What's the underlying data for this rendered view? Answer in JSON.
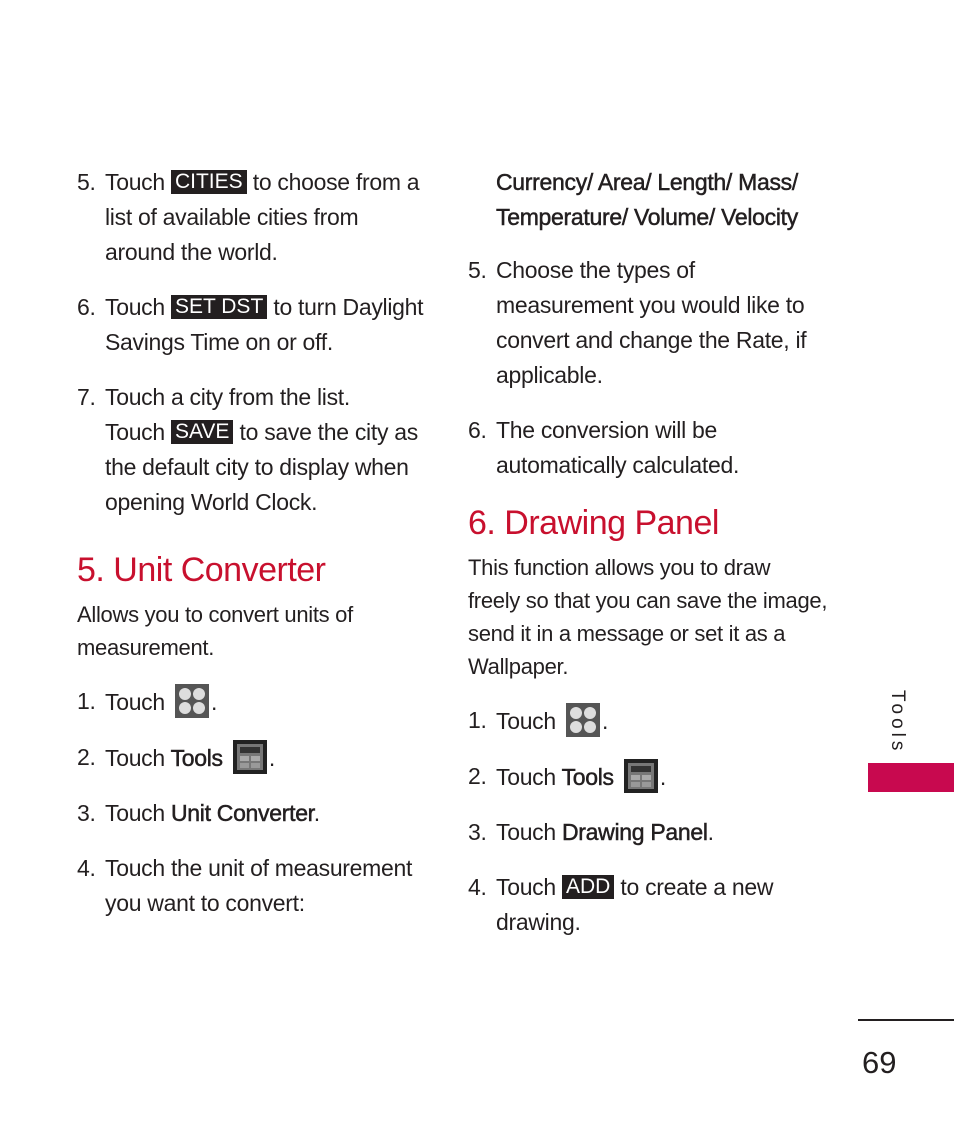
{
  "left_column": {
    "step5": {
      "num": "5.",
      "pre": "Touch",
      "badge": "CITIES",
      "post": "to choose from a list of available cities from around the world."
    },
    "step6": {
      "num": "6.",
      "pre": "Touch",
      "badge": "SET DST",
      "post": "to turn Daylight Savings Time on or off."
    },
    "step7": {
      "num": "7.",
      "line1": "Touch a city from the list.",
      "pre": "Touch",
      "badge": "SAVE",
      "post": "to save the city as the default city to display when opening World Clock."
    },
    "unit_converter": {
      "heading": "5. Unit Converter",
      "intro": "Allows you to convert units of measurement.",
      "steps": [
        {
          "num": "1.",
          "pre": "Touch",
          "icon": "menu-grid-icon",
          "post": "."
        },
        {
          "num": "2.",
          "pre": "Touch",
          "bold": "Tools",
          "icon": "tools-calculator-icon",
          "post": "."
        },
        {
          "num": "3.",
          "pre": "Touch",
          "bold": "Unit Converter",
          "post": "."
        },
        {
          "num": "4.",
          "text": "Touch the unit of measurement you want to convert:"
        }
      ]
    }
  },
  "right_column": {
    "units_list": "Currency/ Area/ Length/ Mass/ Temperature/ Volume/ Velocity",
    "step5": {
      "num": "5.",
      "text": "Choose the types of measurement you would like to convert and change the Rate, if applicable."
    },
    "step6": {
      "num": "6.",
      "text": "The conversion will be automatically calculated."
    },
    "drawing_panel": {
      "heading": "6. Drawing Panel",
      "intro": "This function allows you to draw freely so that you can save the image, send it in a message or set it as a Wallpaper.",
      "steps": [
        {
          "num": "1.",
          "pre": "Touch",
          "icon": "menu-grid-icon",
          "post": "."
        },
        {
          "num": "2.",
          "pre": "Touch",
          "bold": "Tools",
          "icon": "tools-calculator-icon",
          "post": "."
        },
        {
          "num": "3.",
          "pre": "Touch",
          "bold": "Drawing Panel",
          "post": "."
        },
        {
          "num": "4.",
          "pre": "Touch",
          "badge": "ADD",
          "post": "to create a new drawing."
        }
      ]
    }
  },
  "side_tab": {
    "label": "Tools",
    "color": "#c8094f"
  },
  "page_number": "69",
  "accent_color": "#c8102e"
}
